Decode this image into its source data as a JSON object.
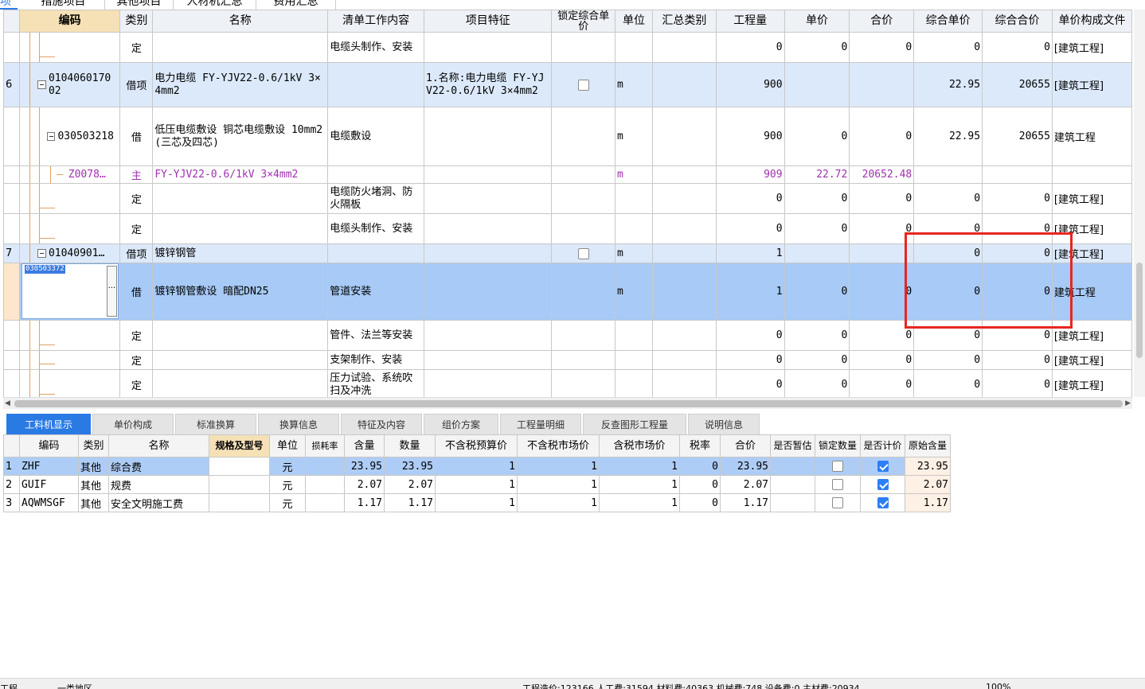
{
  "top_tabs": [
    "项",
    "措施项目",
    "其他项目",
    "人材机汇总",
    "费用汇总"
  ],
  "columns": [
    "编码",
    "类别",
    "名称",
    "清单工作内容",
    "项目特征",
    "锁定综合单价",
    "单位",
    "汇总类别",
    "工程量",
    "单价",
    "合价",
    "综合单价",
    "综合合价",
    "单价构成文件"
  ],
  "rows": [
    {
      "idx": "",
      "code": "",
      "cat": "定",
      "name": "",
      "work": "电缆头制作、安装",
      "feat": "",
      "unit": "",
      "qty": "0",
      "price": "0",
      "total": "0",
      "uprice": "0",
      "utotal": "0",
      "file": "[建筑工程]"
    },
    {
      "idx": "6",
      "code": "010406017002",
      "cat": "借项",
      "name": "电力电缆 FY-YJV22-0.6/1kV 3×4mm2",
      "work": "",
      "feat": "1.名称:电力电缆 FY-YJV22-0.6/1kV 3×4mm2",
      "unit": "m",
      "qty": "900",
      "price": "",
      "total": "",
      "uprice": "22.95",
      "utotal": "20655",
      "file": "[建筑工程]"
    },
    {
      "idx": "",
      "code": "030503218",
      "cat": "借",
      "name": "低压电缆敷设 铜芯电缆敷设 10mm2(三芯及四芯)",
      "work": "电缆敷设",
      "feat": "",
      "unit": "m",
      "qty": "900",
      "price": "0",
      "total": "0",
      "uprice": "22.95",
      "utotal": "20655",
      "file": "建筑工程"
    },
    {
      "idx": "",
      "code": "Z0078…",
      "cat": "主",
      "name": "FY-YJV22-0.6/1kV  3×4mm2",
      "work": "",
      "feat": "",
      "unit": "m",
      "qty": "909",
      "price": "22.72",
      "total": "20652.48",
      "uprice": "",
      "utotal": "",
      "file": ""
    },
    {
      "idx": "",
      "code": "",
      "cat": "定",
      "name": "",
      "work": "电缆防火堵洞、防火隔板",
      "feat": "",
      "unit": "",
      "qty": "0",
      "price": "0",
      "total": "0",
      "uprice": "0",
      "utotal": "0",
      "file": "[建筑工程]"
    },
    {
      "idx": "",
      "code": "",
      "cat": "定",
      "name": "",
      "work": "电缆头制作、安装",
      "feat": "",
      "unit": "",
      "qty": "0",
      "price": "0",
      "total": "0",
      "uprice": "0",
      "utotal": "0",
      "file": "[建筑工程]"
    },
    {
      "idx": "7",
      "code": "01040901…",
      "cat": "借项",
      "name": "镀锌钢管",
      "work": "",
      "feat": "",
      "unit": "m",
      "qty": "1",
      "price": "",
      "total": "",
      "uprice": "0",
      "utotal": "0",
      "file": "[建筑工程]"
    },
    {
      "idx": "",
      "code": "030503372",
      "cat": "借",
      "name": "镀锌钢管敷设 暗配DN25",
      "work": "管道安装",
      "feat": "",
      "unit": "m",
      "qty": "1",
      "price": "0",
      "total": "0",
      "uprice": "0",
      "utotal": "0",
      "file": "建筑工程"
    },
    {
      "idx": "",
      "code": "",
      "cat": "定",
      "name": "",
      "work": "管件、法兰等安装",
      "feat": "",
      "unit": "",
      "qty": "0",
      "price": "0",
      "total": "0",
      "uprice": "0",
      "utotal": "0",
      "file": "[建筑工程]"
    },
    {
      "idx": "",
      "code": "",
      "cat": "定",
      "name": "",
      "work": "支架制作、安装",
      "feat": "",
      "unit": "",
      "qty": "0",
      "price": "0",
      "total": "0",
      "uprice": "0",
      "utotal": "0",
      "file": "[建筑工程]"
    },
    {
      "idx": "",
      "code": "",
      "cat": "定",
      "name": "",
      "work": "压力试验、系统吹扫及冲洗",
      "feat": "",
      "unit": "",
      "qty": "0",
      "price": "0",
      "total": "0",
      "uprice": "0",
      "utotal": "0",
      "file": "[建筑工程]"
    }
  ],
  "bottom_tabs": [
    "工料机显示",
    "单价构成",
    "标准换算",
    "换算信息",
    "特征及内容",
    "组价方案",
    "工程量明细",
    "反查图形工程量",
    "说明信息"
  ],
  "bottom_columns": [
    "编码",
    "类别",
    "名称",
    "规格及型号",
    "单位",
    "损耗率",
    "含量",
    "数量",
    "不含税预算价",
    "不含税市场价",
    "含税市场价",
    "税率",
    "合价",
    "是否暂估",
    "锁定数量",
    "是否计价",
    "原始含量"
  ],
  "bottom_rows": [
    {
      "idx": "1",
      "code": "ZHF",
      "cat": "其他",
      "name": "综合费",
      "spec": "",
      "unit": "元",
      "loss": "",
      "content": "23.95",
      "qty": "23.95",
      "p1": "1",
      "p2": "1",
      "p3": "1",
      "tax": "0",
      "total": "23.95",
      "est": "",
      "lock": false,
      "priced": true,
      "orig": "23.95"
    },
    {
      "idx": "2",
      "code": "GUIF",
      "cat": "其他",
      "name": "规费",
      "spec": "",
      "unit": "元",
      "loss": "",
      "content": "2.07",
      "qty": "2.07",
      "p1": "1",
      "p2": "1",
      "p3": "1",
      "tax": "0",
      "total": "2.07",
      "est": "",
      "lock": false,
      "priced": true,
      "orig": "2.07"
    },
    {
      "idx": "3",
      "code": "AQWMSGF",
      "cat": "其他",
      "name": "安全文明施工费",
      "spec": "",
      "unit": "元",
      "loss": "",
      "content": "1.17",
      "qty": "1.17",
      "p1": "1",
      "p2": "1",
      "p3": "1",
      "tax": "0",
      "total": "1.17",
      "est": "",
      "lock": false,
      "priced": true,
      "orig": "1.17"
    }
  ],
  "status": {
    "left1": "工程",
    "left2": "一类地区",
    "summary": "工程造价:123166  人工费:31594  材料费:40363  机械费:748  设备费:0  主材费:20934",
    "zoom": "100%"
  },
  "colors": {
    "highlight_box": "#e8261f",
    "selected_row": "#a7caf7",
    "active_tab": "#2a7ae4"
  }
}
